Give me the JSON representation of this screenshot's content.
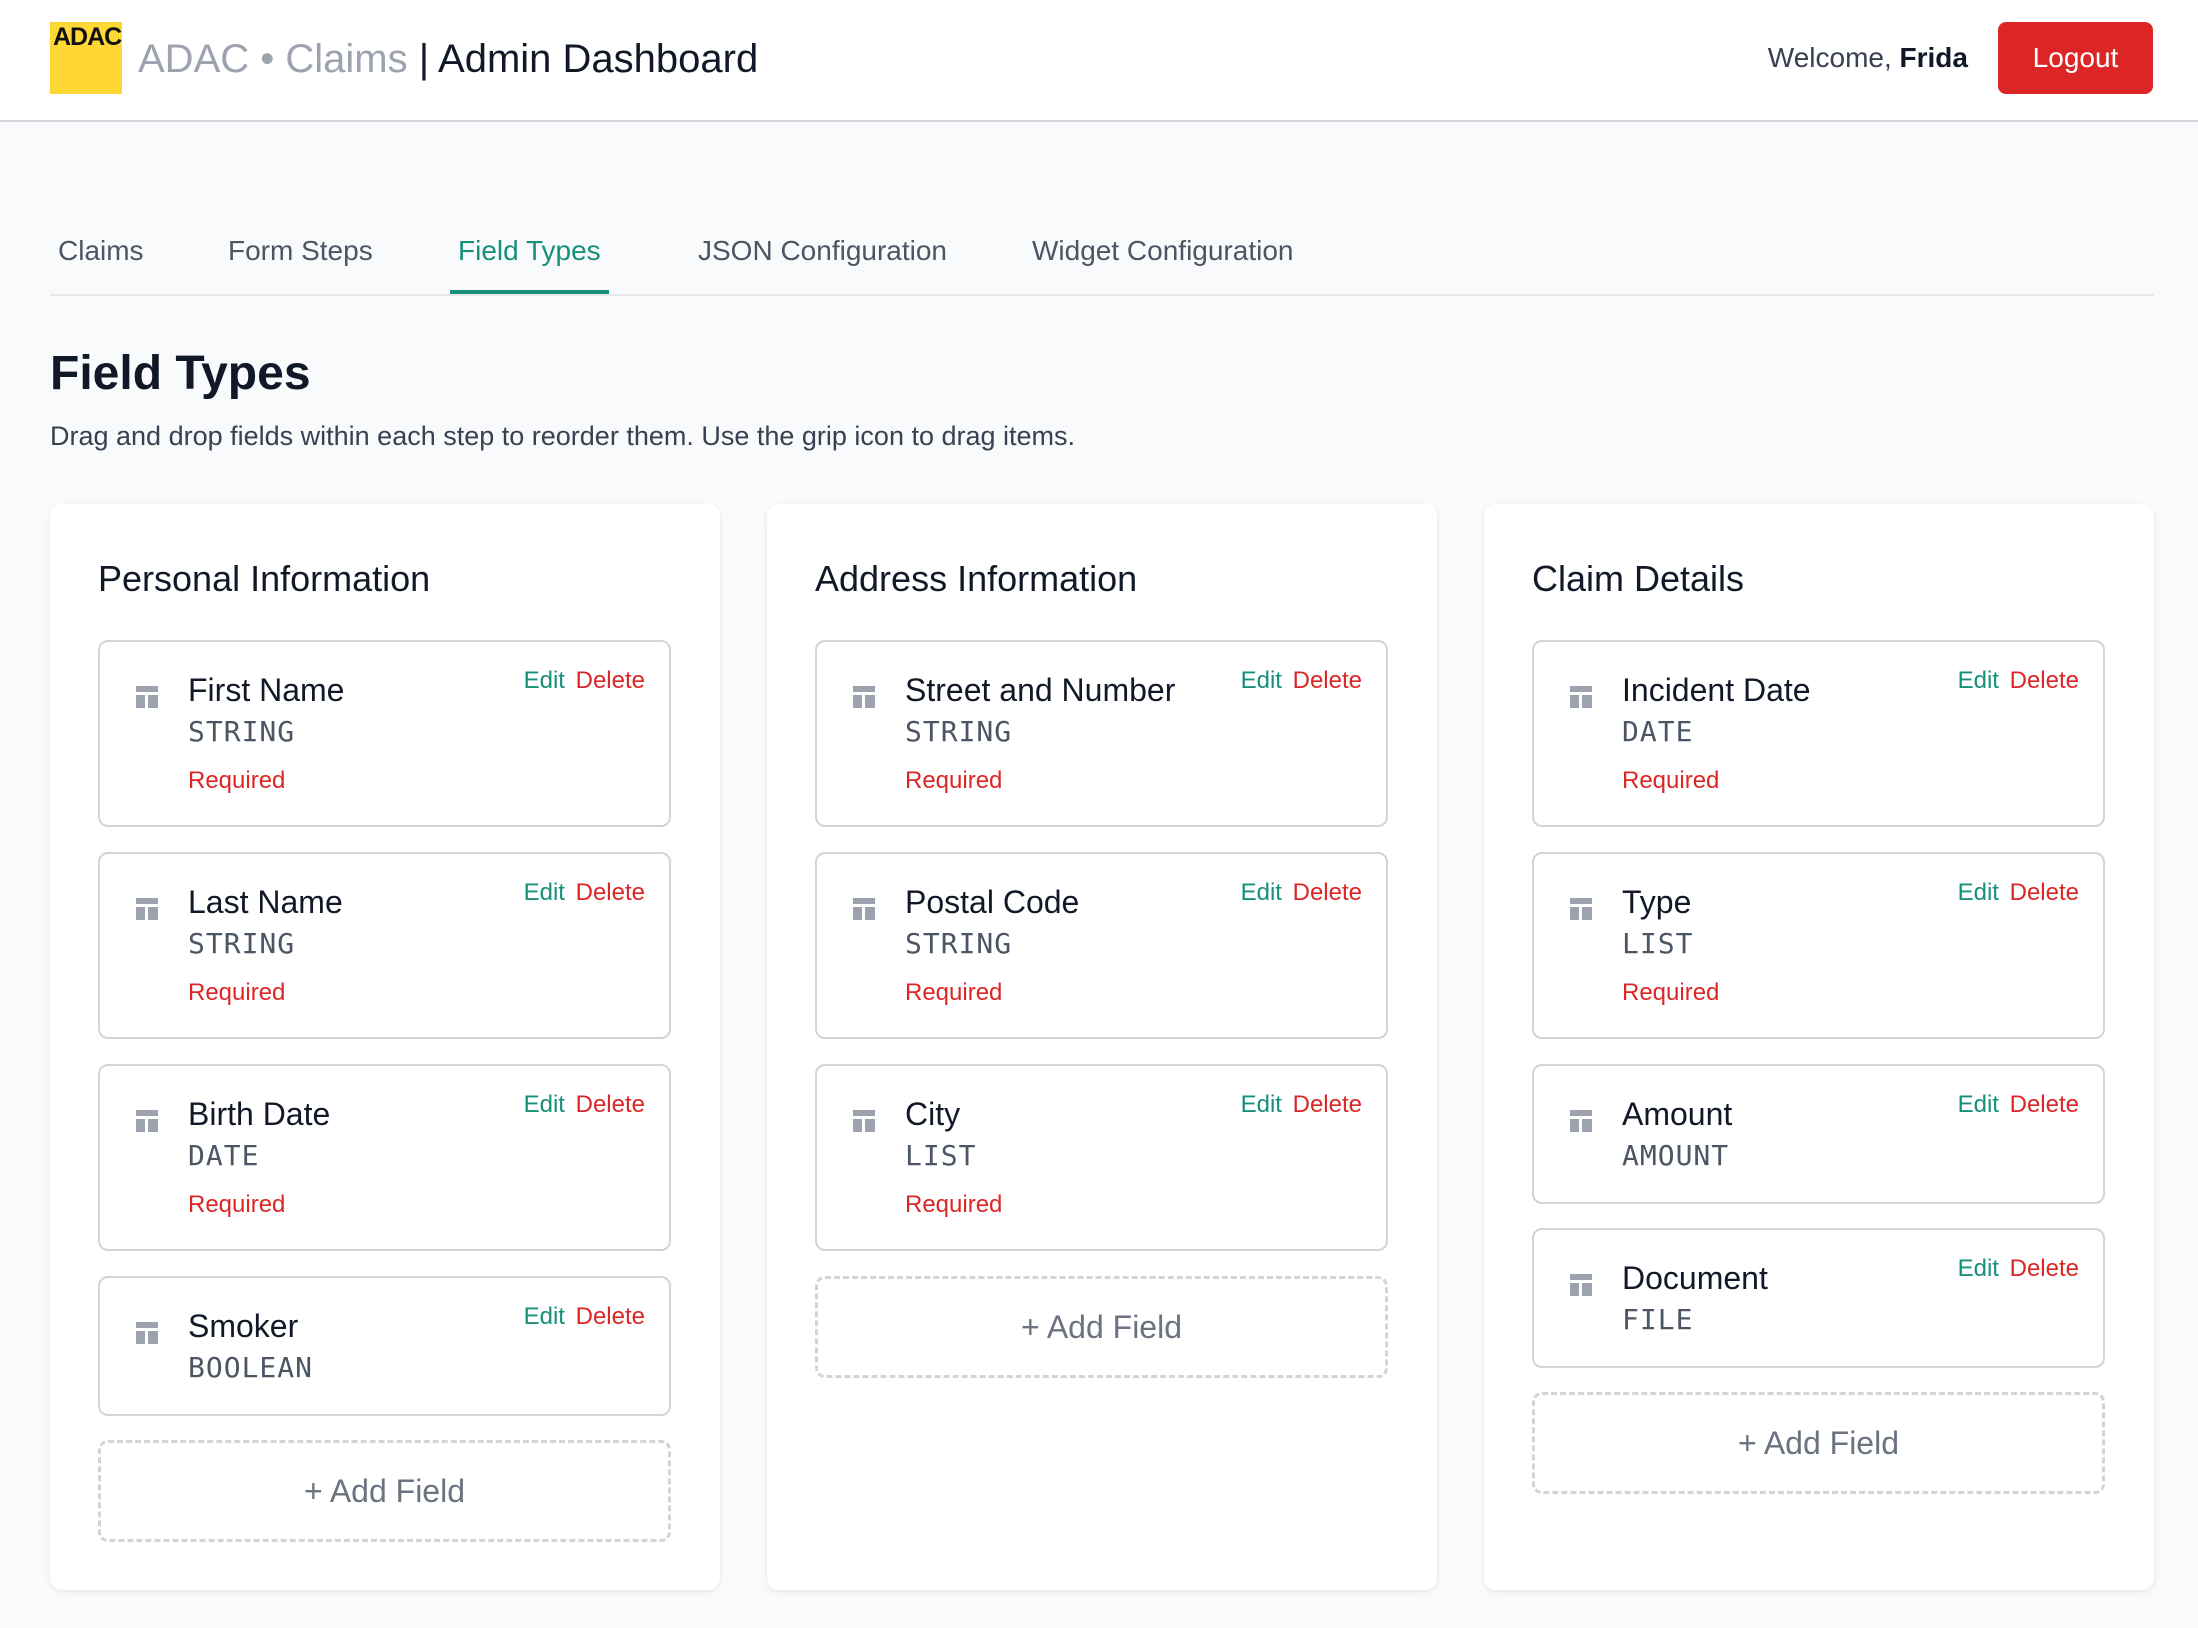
{
  "header": {
    "logo_text": "ADAC",
    "brand_prefix": "ADAC • Claims",
    "brand_sep": " | ",
    "brand_title": "Admin Dashboard",
    "welcome_prefix": "Welcome, ",
    "user_name": "Frida",
    "logout_label": "Logout"
  },
  "tabs": [
    {
      "label": "Claims"
    },
    {
      "label": "Form Steps"
    },
    {
      "label": "Field Types"
    },
    {
      "label": "JSON Configuration"
    },
    {
      "label": "Widget Configuration"
    }
  ],
  "active_tab": "Field Types",
  "page": {
    "title": "Field Types",
    "description": "Drag and drop fields within each step to reorder them. Use the grip icon to drag items."
  },
  "labels": {
    "edit": "Edit",
    "delete": "Delete",
    "add_field": "+ Add Field"
  },
  "steps": [
    {
      "title": "Personal Information",
      "fields": [
        {
          "name": "First Name",
          "type": "STRING",
          "required": "Required"
        },
        {
          "name": "Last Name",
          "type": "STRING",
          "required": "Required"
        },
        {
          "name": "Birth Date",
          "type": "DATE",
          "required": "Required"
        },
        {
          "name": "Smoker",
          "type": "BOOLEAN"
        }
      ]
    },
    {
      "title": "Address Information",
      "fields": [
        {
          "name": "Street and Number",
          "type": "STRING",
          "required": "Required"
        },
        {
          "name": "Postal Code",
          "type": "STRING",
          "required": "Required"
        },
        {
          "name": "City",
          "type": "LIST",
          "required": "Required"
        }
      ]
    },
    {
      "title": "Claim Details",
      "fields": [
        {
          "name": "Incident Date",
          "type": "DATE",
          "required": "Required"
        },
        {
          "name": "Type",
          "type": "LIST",
          "required": "Required"
        },
        {
          "name": "Amount",
          "type": "AMOUNT"
        },
        {
          "name": "Document",
          "type": "FILE"
        }
      ]
    }
  ],
  "colors": {
    "accent": "#16907a",
    "danger": "#dc2626",
    "logo": "#ffd835"
  }
}
